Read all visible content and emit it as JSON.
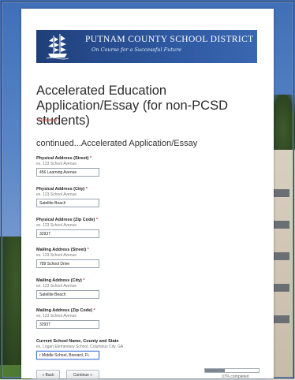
{
  "banner": {
    "district_name": "PUTNAM COUNTY SCHOOL DISTRICT",
    "motto": "On Course for a Successful Future"
  },
  "form": {
    "title": "Accelerated Education Application/Essay (for non-PCSD students)",
    "required_note": "* Required",
    "section_title": "continued...Accelerated Application/Essay"
  },
  "fields": [
    {
      "label": "Physical Address (Street)",
      "required": true,
      "hint": "ex. 123 School Avenue",
      "value": "456  Learning Avenue"
    },
    {
      "label": "Physical Address (City)",
      "required": true,
      "hint": "ex. 123 School Avenue",
      "value": "Satellite Beach"
    },
    {
      "label": "Physical Address (Zip Code)",
      "required": true,
      "hint": "ex. 123 School Avenue",
      "value": "32937"
    },
    {
      "label": "Mailing Address (Street)",
      "required": true,
      "hint": "ex. 123 School Avenue",
      "value": "789 School Drive"
    },
    {
      "label": "Mailing Address (City)",
      "required": true,
      "hint": "ex. 123 School Avenue",
      "value": "Satellite Beach"
    },
    {
      "label": "Mailing Address (Zip Code)",
      "required": true,
      "hint": "ex. 123 School Avenue",
      "value": "32937"
    },
    {
      "label": "Current School Name, County and State",
      "required": false,
      "hint": "ex. Logan Elementary School, Columbus City, GA",
      "value": "r Middle School, Brevard, FL"
    }
  ],
  "buttons": {
    "back": "« Back",
    "continue": "Continue »"
  },
  "progress": {
    "fraction": 0.37,
    "text": "37% completed"
  },
  "colors": {
    "banner": "#1f3f7a",
    "required": "#c0392b",
    "focus_border": "#4a7bd6"
  }
}
